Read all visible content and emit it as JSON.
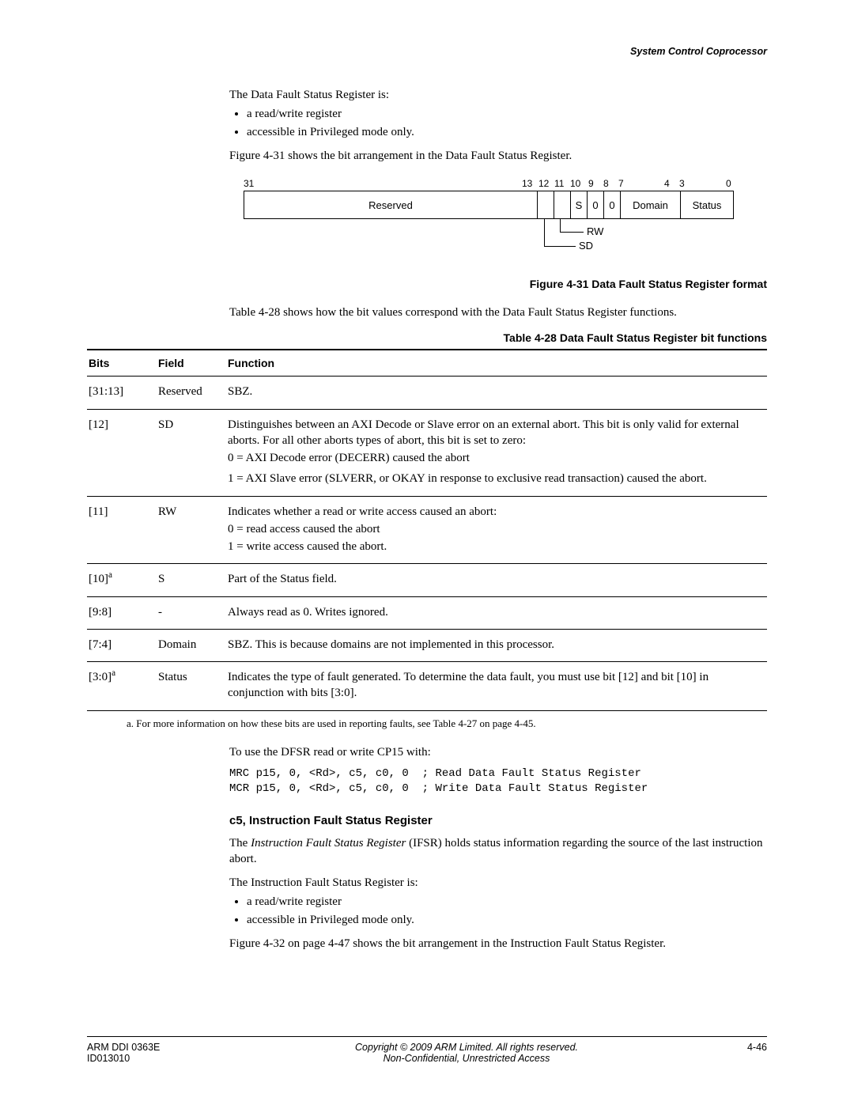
{
  "header": {
    "running": "System Control Coprocessor"
  },
  "intro": {
    "p1": "The Data Fault Status Register is:",
    "li1": "a read/write register",
    "li2": "accessible in Privileged mode only.",
    "p2": "Figure 4-31 shows the bit arrangement in the Data Fault Status Register."
  },
  "register": {
    "bits": {
      "b31": "31",
      "b13": "13",
      "b12": "12",
      "b11": "11",
      "b10": "10",
      "b9": "9",
      "b8": "8",
      "b7": "7",
      "b4": "4",
      "b3": "3",
      "b0": "0"
    },
    "cells": {
      "reserved": "Reserved",
      "s": "S",
      "z1": "0",
      "z2": "0",
      "domain": "Domain",
      "status": "Status"
    },
    "annot": {
      "rw": "RW",
      "sd": "SD"
    }
  },
  "fig_caption": "Figure 4-31 Data Fault Status Register format",
  "table_intro": "Table 4-28 shows how the bit values correspond with the Data Fault Status Register functions.",
  "table_caption": "Table 4-28 Data Fault Status Register bit functions",
  "table": {
    "head": {
      "bits": "Bits",
      "field": "Field",
      "func": "Function"
    },
    "rows": [
      {
        "bits": "[31:13]",
        "field": "Reserved",
        "func_lines": [
          "SBZ."
        ]
      },
      {
        "bits": "[12]",
        "field": "SD",
        "func_lines": [
          "Distinguishes between an AXI Decode or Slave error on an external abort. This bit is only valid for external aborts. For all other aborts types of abort, this bit is set to zero:",
          "0 = AXI Decode error (DECERR) caused the abort",
          "1 = AXI Slave error (SLVERR, or OKAY in response to exclusive read transaction) caused the abort."
        ]
      },
      {
        "bits": "[11]",
        "field": "RW",
        "func_lines": [
          "Indicates whether a read or write access caused an abort:",
          "0 = read access caused the abort",
          "1 = write access caused the abort."
        ]
      },
      {
        "bits": "[10]",
        "sup": "a",
        "field": "S",
        "func_lines": [
          "Part of the Status field."
        ]
      },
      {
        "bits": "[9:8]",
        "field": "-",
        "func_lines": [
          "Always read as 0. Writes ignored."
        ]
      },
      {
        "bits": "[7:4]",
        "field": "Domain",
        "func_lines": [
          "SBZ. This is because domains are not implemented in this processor."
        ]
      },
      {
        "bits": "[3:0]",
        "sup": "a",
        "field": "Status",
        "func_lines": [
          "Indicates the type of fault generated. To determine the data fault, you must use bit [12] and bit [10] in conjunction with bits [3:0]."
        ]
      }
    ]
  },
  "footnote": "a.   For more information on how these bits are used in reporting faults, see Table 4-27 on page 4-45.",
  "after": {
    "use": "To use the DFSR read or write CP15 with:",
    "code": "MRC p15, 0, <Rd>, c5, c0, 0  ; Read Data Fault Status Register\nMCR p15, 0, <Rd>, c5, c0, 0  ; Write Data Fault Status Register",
    "heading": "c5, Instruction Fault Status Register",
    "ifsr1a": "The ",
    "ifsr_term": "Instruction Fault Status Register",
    "ifsr1b": " (IFSR) holds status information regarding the source of the last instruction abort.",
    "ifsr2": "The Instruction Fault Status Register is:",
    "ifsr_li1": "a read/write register",
    "ifsr_li2": "accessible in Privileged mode only.",
    "ifsr3": "Figure 4-32 on page 4-47 shows the bit arrangement in the Instruction Fault Status Register."
  },
  "footer": {
    "left1": "ARM DDI 0363E",
    "left2": "ID013010",
    "center1": "Copyright © 2009 ARM Limited. All rights reserved.",
    "center2": "Non-Confidential, Unrestricted Access",
    "right": "4-46"
  }
}
